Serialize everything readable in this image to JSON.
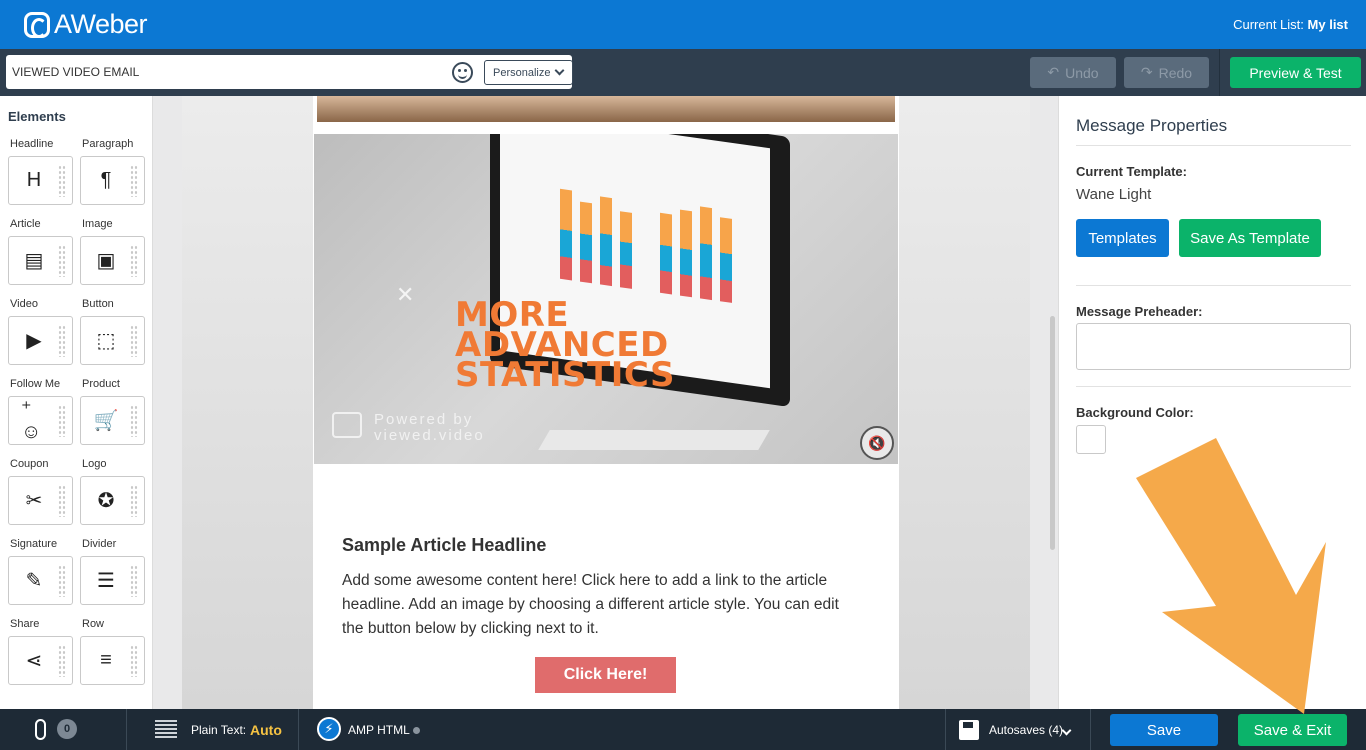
{
  "header": {
    "brand": "AWeber",
    "current_list_label": "Current List:",
    "current_list_value": "My list"
  },
  "toolbar": {
    "subject_value": "VIEWED VIDEO EMAIL",
    "personalize_label": "Personalize",
    "undo_label": "Undo",
    "redo_label": "Redo",
    "preview_label": "Preview & Test"
  },
  "elements": {
    "title": "Elements",
    "items": [
      {
        "label": "Headline",
        "icon": "H"
      },
      {
        "label": "Paragraph",
        "icon": "¶"
      },
      {
        "label": "Article",
        "icon": "▤"
      },
      {
        "label": "Image",
        "icon": "▣"
      },
      {
        "label": "Video",
        "icon": "▶"
      },
      {
        "label": "Button",
        "icon": "⬚"
      },
      {
        "label": "Follow Me",
        "icon": "⁺☺"
      },
      {
        "label": "Product",
        "icon": "🛒"
      },
      {
        "label": "Coupon",
        "icon": "✂"
      },
      {
        "label": "Logo",
        "icon": "✪"
      },
      {
        "label": "Signature",
        "icon": "✎"
      },
      {
        "label": "Divider",
        "icon": "☰"
      },
      {
        "label": "Share",
        "icon": "⋖"
      },
      {
        "label": "Row",
        "icon": "≡"
      }
    ]
  },
  "email": {
    "video_text_line1": "MORE",
    "video_text_line2": "ADVANCED",
    "video_text_line3": "STATISTICS",
    "powered_line1": "Powered by",
    "powered_line2": "viewed.video",
    "article_title": "Sample Article Headline",
    "article_body": "Add some awesome content here! Click here to add a link to the article headline. Add an image by choosing a different article style. You can edit the button below by clicking next to it.",
    "cta_label": "Click Here!"
  },
  "properties": {
    "title": "Message Properties",
    "current_template_label": "Current Template:",
    "current_template_value": "Wane Light",
    "templates_button": "Templates",
    "save_as_template_button": "Save As Template",
    "preheader_label": "Message Preheader:",
    "preheader_value": "",
    "background_color_label": "Background Color:"
  },
  "bottombar": {
    "attachments_count": "0",
    "plain_text_label": "Plain Text:",
    "plain_text_value": "Auto",
    "amp_label": "AMP HTML",
    "autosaves_label": "Autosaves (4)",
    "save_label": "Save",
    "save_exit_label": "Save & Exit"
  },
  "colors": {
    "brand_blue": "#0c78d3",
    "action_green": "#0bb36a",
    "toolbar_dark": "#2f3e4e",
    "annotation_orange": "#f5a94a",
    "cta_red": "#e06c6c"
  }
}
